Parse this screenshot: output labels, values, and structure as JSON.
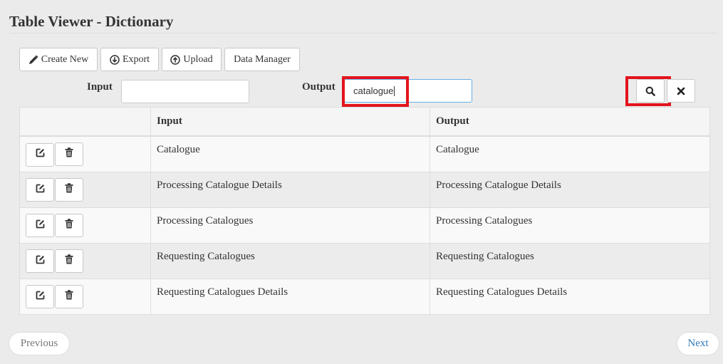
{
  "header": {
    "title": "Table Viewer - Dictionary"
  },
  "toolbar": {
    "create_label": "Create New",
    "export_label": "Export",
    "upload_label": "Upload",
    "data_manager_label": "Data Manager"
  },
  "filters": {
    "input_label": "Input",
    "input_value": "",
    "output_label": "Output",
    "output_value": "catalogue"
  },
  "table": {
    "columns": [
      "",
      "Input",
      "Output"
    ],
    "rows": [
      {
        "input": "Catalogue",
        "output": "Catalogue"
      },
      {
        "input": "Processing Catalogue Details",
        "output": "Processing Catalogue Details"
      },
      {
        "input": "Processing Catalogues",
        "output": "Processing Catalogues"
      },
      {
        "input": "Requesting Catalogues",
        "output": "Requesting Catalogues"
      },
      {
        "input": "Requesting Catalogues Details",
        "output": "Requesting Catalogues Details"
      }
    ]
  },
  "pagination": {
    "previous_label": "Previous",
    "next_label": "Next"
  },
  "icons": {
    "create": "pencil-icon",
    "export": "download-circle-icon",
    "upload": "upload-circle-icon",
    "search": "search-icon",
    "clear": "close-icon",
    "edit": "edit-icon",
    "delete": "trash-icon"
  },
  "colors": {
    "highlight": "#e3141c",
    "focus_border": "#66afe9",
    "link": "#337ab7",
    "disabled_text": "#777777"
  }
}
